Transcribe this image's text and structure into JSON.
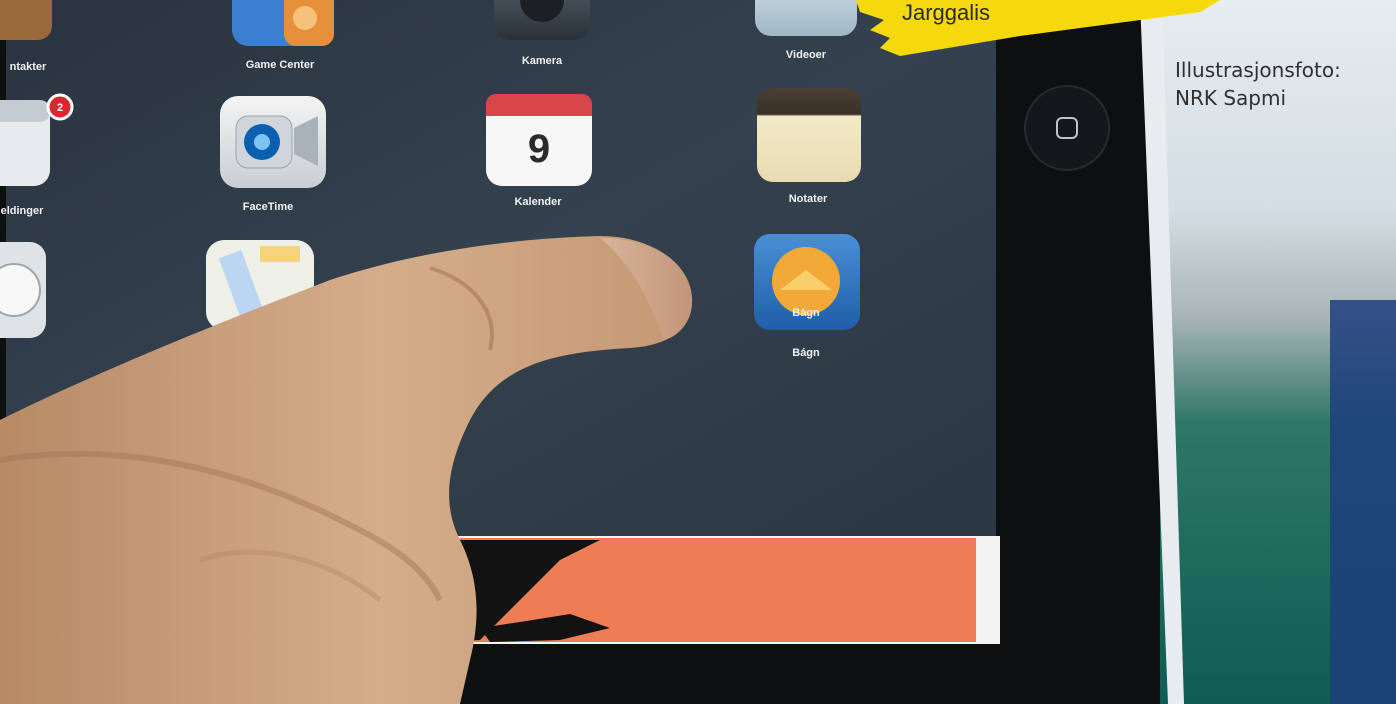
{
  "photo": {
    "caption_lines": [
      "Illustrasjonsfoto:",
      "NRK Sapmi"
    ],
    "icons": [
      {
        "name": "contacts",
        "label": "ntakter"
      },
      {
        "name": "game-center",
        "label": "Game Center"
      },
      {
        "name": "camera",
        "label": "Kamera"
      },
      {
        "name": "videos",
        "label": "Videoer"
      },
      {
        "name": "messages",
        "label": "eldinger",
        "badge": "2"
      },
      {
        "name": "facetime",
        "label": "FaceTime"
      },
      {
        "name": "calendar",
        "label": "Kalender",
        "day": "9"
      },
      {
        "name": "notes",
        "label": "Notater"
      },
      {
        "name": "weather",
        "label": "Bágn"
      }
    ],
    "sticker_text": "Jarggalis",
    "colors": {
      "screen": "#2f3b47",
      "bezel": "#0e0f10",
      "sticker": "#f5d90a",
      "banner": "#ee7d56",
      "finger": "#c99f7d",
      "teal": "#0b6f62"
    }
  }
}
